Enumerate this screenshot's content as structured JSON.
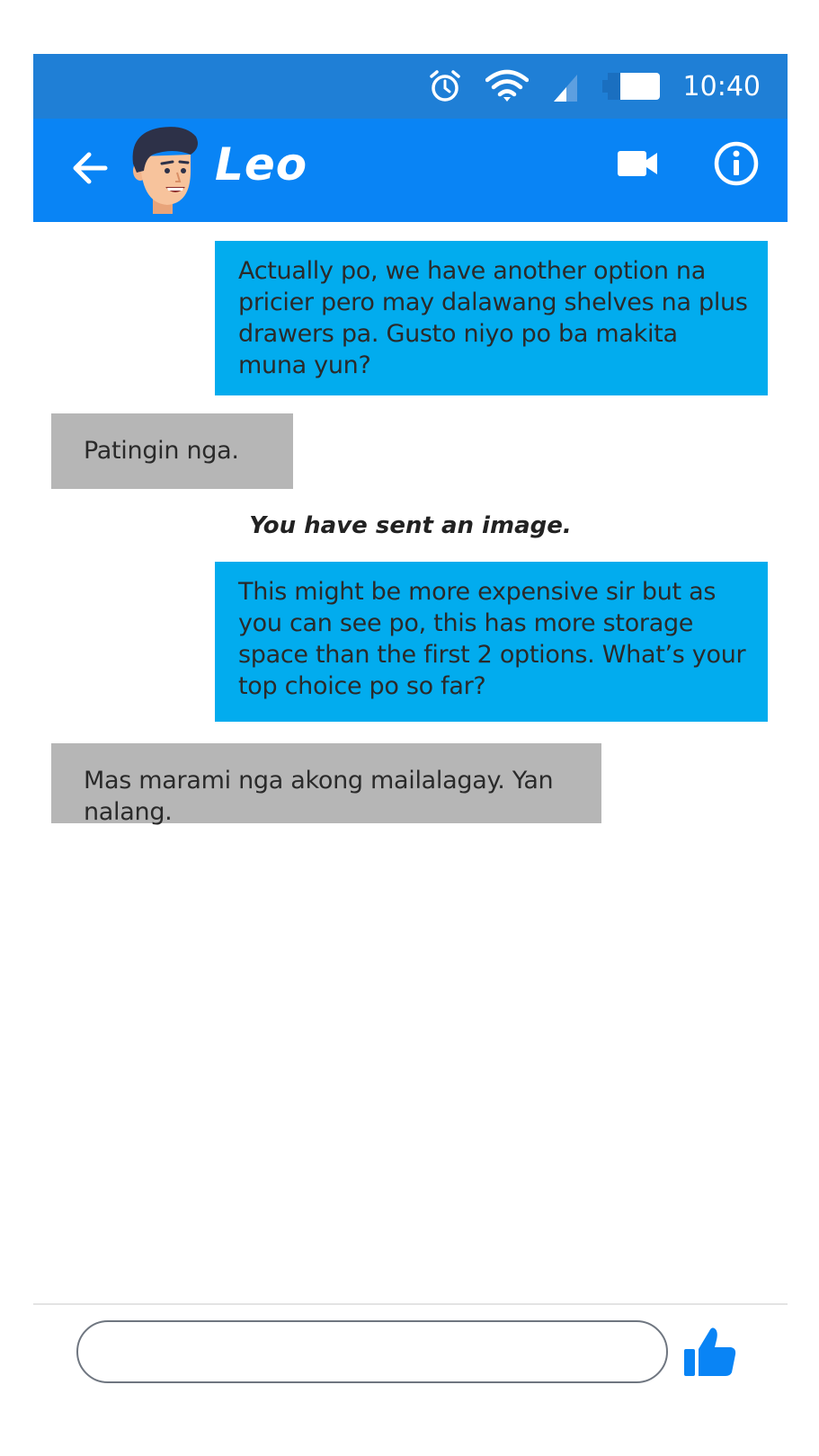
{
  "status_bar": {
    "time": "10:40",
    "icons": [
      "alarm-icon",
      "wifi-icon",
      "signal-icon",
      "battery-icon"
    ],
    "color": "#1f7fd6"
  },
  "header": {
    "contact_name": "Leo",
    "color": "#0984f5",
    "icons": [
      "back-arrow-icon",
      "video-call-icon",
      "info-icon"
    ]
  },
  "messages": [
    {
      "direction": "sent",
      "text": "Actually po, we have another option na pricier pero may dalawang shelves na plus drawers pa. Gusto niyo po ba makita muna yun?"
    },
    {
      "direction": "received",
      "text": "Patingin nga."
    },
    {
      "direction": "system",
      "text": "You have sent an image."
    },
    {
      "direction": "sent",
      "text": "This might be more expensive sir but as you can see po, this has more storage space than the first 2 options. What’s your top choice po so far?"
    },
    {
      "direction": "received",
      "text": "Mas marami nga akong mailalagay. Yan nalang."
    }
  ],
  "composer": {
    "value": "",
    "placeholder": "",
    "send_icon": "thumbs-up-icon"
  },
  "colors": {
    "sent_bubble": "#02acee",
    "received_bubble": "#b6b6b6",
    "accent": "#0984f5"
  }
}
